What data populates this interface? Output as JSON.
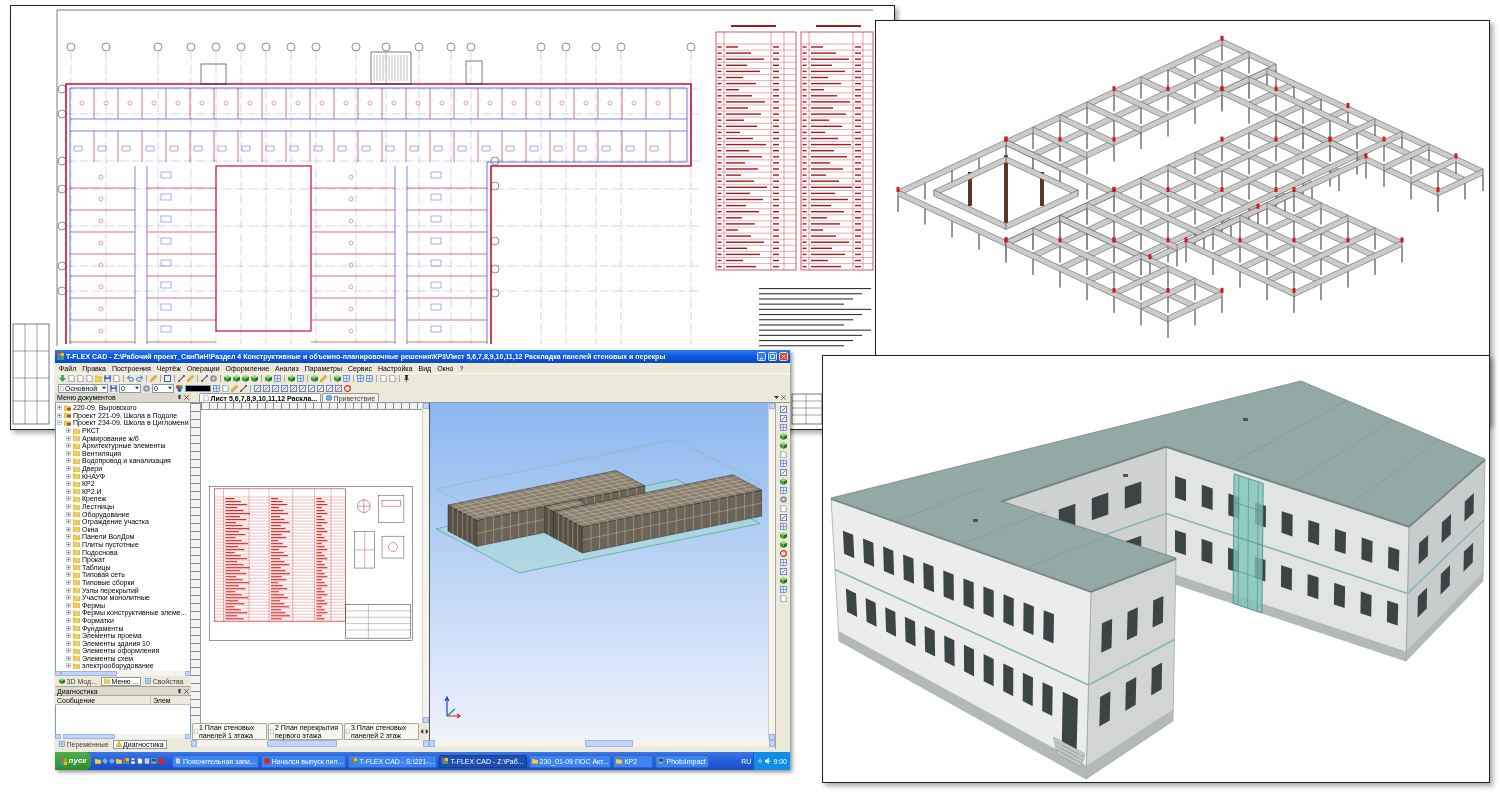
{
  "cad_window": {
    "title": "T-FLEX CAD - Z:\\Рабочий проект_СанПиН\\Раздел 4 Конструктивные и объемно-планировочные решения\\КР3\\Лист 5,6,7,8,9,10,11,12 Раскладка панелей стеновых и перекры",
    "menu": [
      "Файл",
      "Правка",
      "Построения",
      "Чертёж",
      "Операции",
      "Оформление",
      "Анализ",
      "Параметры",
      "Сервис",
      "Настройка",
      "Вид",
      "Окно",
      "?"
    ],
    "toolbar": {
      "dropdown": "Основной",
      "fields": [
        "0",
        "0"
      ]
    },
    "documents_panel": {
      "title": "Меню документов",
      "tree": [
        {
          "label": "220-09. Выровского",
          "expanded": false
        },
        {
          "label": "Проект 221-09. Школа в Подоле",
          "expanded": false
        },
        {
          "label": "Проект 234-09. Школа в Цигломени",
          "expanded": true,
          "children": [
            {
              "label": "РКСТ",
              "expanded": false
            },
            {
              "label": "Армирование ж/б",
              "expanded": false
            },
            {
              "label": "Архитектурные элементы",
              "expanded": false
            },
            {
              "label": "Вентиляция",
              "expanded": false
            },
            {
              "label": "Водопровод и канализация",
              "expanded": false
            },
            {
              "label": "Двери",
              "expanded": false
            },
            {
              "label": "КНАУФ",
              "expanded": false
            },
            {
              "label": "КР2",
              "expanded": false
            },
            {
              "label": "КР2.И",
              "expanded": false
            },
            {
              "label": "Крепеж",
              "expanded": false
            },
            {
              "label": "Лестницы",
              "expanded": false
            },
            {
              "label": "Оборудование",
              "expanded": false
            },
            {
              "label": "Ограждение участка",
              "expanded": false
            },
            {
              "label": "Окна",
              "expanded": false
            },
            {
              "label": "Панели ВолДом",
              "expanded": false
            },
            {
              "label": "Плиты пустотные",
              "expanded": false
            },
            {
              "label": "Подоснова",
              "expanded": false
            },
            {
              "label": "Прокат",
              "expanded": false
            },
            {
              "label": "Таблицы",
              "expanded": false
            },
            {
              "label": "Типовая сеть",
              "expanded": false
            },
            {
              "label": "Типовые сборки",
              "expanded": false
            },
            {
              "label": "Узлы перекрытий",
              "expanded": false
            },
            {
              "label": "Участки монолитные",
              "expanded": false
            },
            {
              "label": "Фермы",
              "expanded": false
            },
            {
              "label": "Фермы конструктивные элеме...",
              "expanded": false
            },
            {
              "label": "Форматки",
              "expanded": false
            },
            {
              "label": "Фундаменты",
              "expanded": false
            },
            {
              "label": "Элементы проема",
              "expanded": false
            },
            {
              "label": "Элементы здания 10",
              "expanded": false
            },
            {
              "label": "Элементы оформления",
              "expanded": false
            },
            {
              "label": "Элементы схем",
              "expanded": false
            },
            {
              "label": "электрооборудование",
              "expanded": false
            }
          ]
        }
      ]
    },
    "panel_tabs": [
      {
        "label": "3D Мод...",
        "selected": false
      },
      {
        "label": "Меню ...",
        "selected": true
      },
      {
        "label": "Свойства",
        "selected": false
      }
    ],
    "diagnostics": {
      "title": "Диагностика",
      "columns": [
        "Сообщение",
        "Элем"
      ]
    },
    "bottom_tabs": [
      {
        "label": "Переменные",
        "selected": false
      },
      {
        "label": "Диагностика",
        "selected": true
      }
    ],
    "document_tabs": [
      {
        "label": "Лист 5,6,7,8,9,10,11,12 Раскла...",
        "selected": true
      },
      {
        "label": "Приветствие",
        "selected": false
      }
    ],
    "sheet_tabs": [
      "1 План стеновых панелей 1 этажа",
      "2 План перекрытия первого этажа",
      "3 План стеновых панелей 2 этаж"
    ]
  },
  "taskbar": {
    "start": "пуск",
    "tasks": [
      {
        "label": "Пояснительная запи...",
        "selected": false
      },
      {
        "label": "Начался выпуск пил...",
        "selected": false
      },
      {
        "label": "T-FLEX CAD - S:\\221-...",
        "selected": false
      },
      {
        "label": "T-FLEX CAD - Z:\\Раб...",
        "selected": true
      },
      {
        "label": "230_01-09 ПОС Акт...",
        "selected": false
      },
      {
        "label": "КР2",
        "selected": false
      },
      {
        "label": "PhotoImpact",
        "selected": false
      }
    ],
    "language": "RU",
    "clock": "9:00"
  }
}
